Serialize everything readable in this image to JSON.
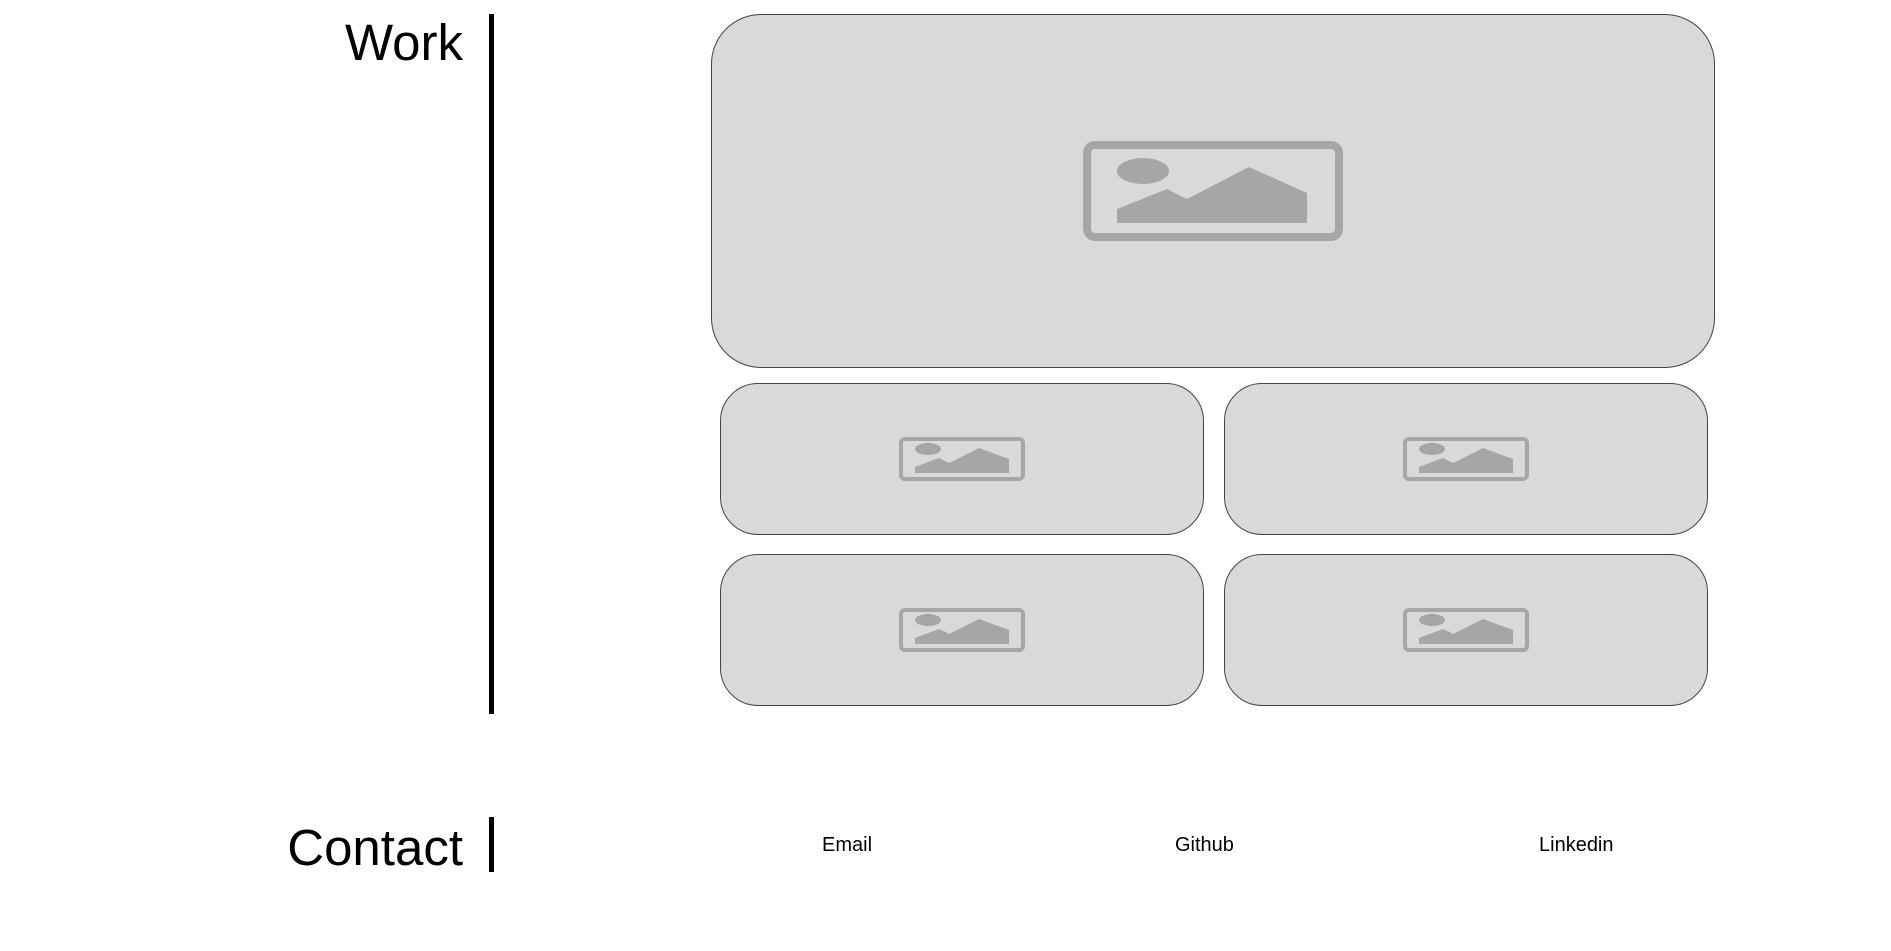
{
  "colors": {
    "card_fill": "#d9d9d9",
    "card_border": "#444444",
    "placeholder_icon": "#a6a6a6",
    "text": "#000000",
    "background": "#ffffff"
  },
  "work": {
    "title": "Work",
    "projects": [
      {
        "icon": "image-placeholder-icon"
      },
      {
        "icon": "image-placeholder-icon"
      },
      {
        "icon": "image-placeholder-icon"
      },
      {
        "icon": "image-placeholder-icon"
      },
      {
        "icon": "image-placeholder-icon"
      }
    ]
  },
  "contact": {
    "title": "Contact",
    "links": [
      {
        "label": "Email"
      },
      {
        "label": "Github"
      },
      {
        "label": "Linkedin"
      }
    ]
  }
}
